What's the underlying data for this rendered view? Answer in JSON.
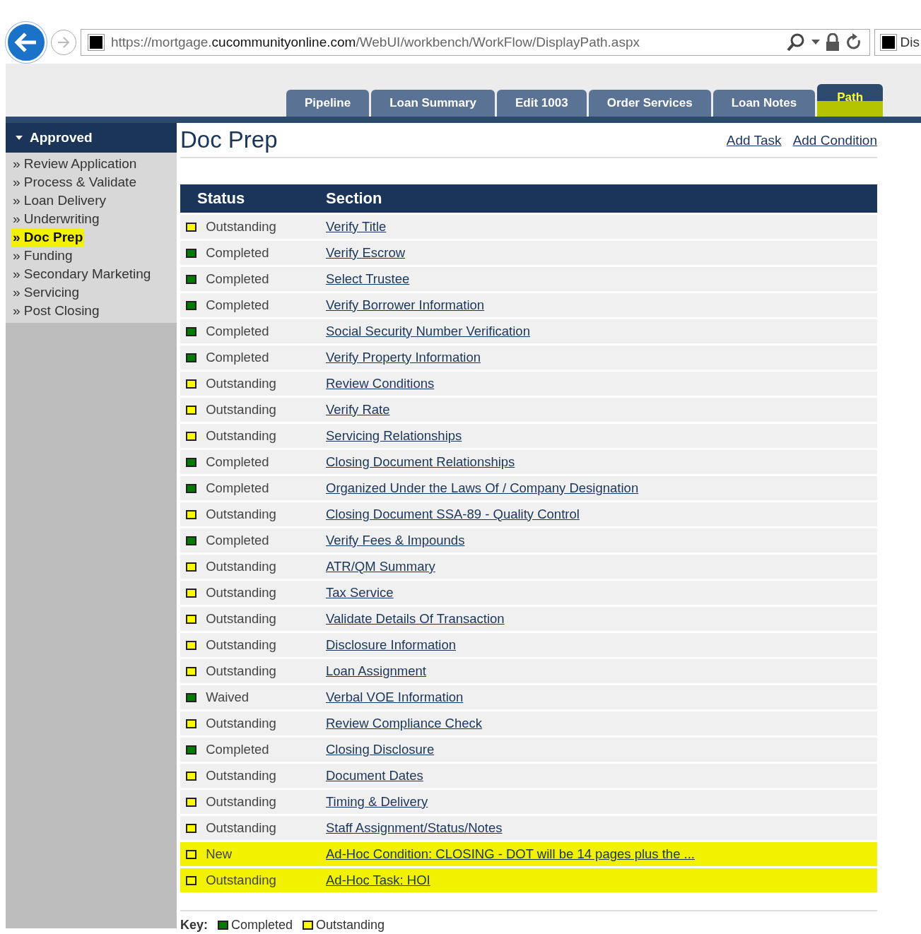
{
  "browser": {
    "url": {
      "scheme": "https://mortgage.",
      "domain": "cucommunityonline.com",
      "path": "/WebUI/workbench/WorkFlow/DisplayPath.aspx"
    },
    "next_tab": "Dis"
  },
  "tabs": [
    {
      "label": "Pipeline",
      "selected": false,
      "highlighted": false
    },
    {
      "label": "Loan Summary",
      "selected": false,
      "highlighted": false
    },
    {
      "label": "Edit 1003",
      "selected": false,
      "highlighted": false
    },
    {
      "label": "Order Services",
      "selected": false,
      "highlighted": false
    },
    {
      "label": "Loan Notes",
      "selected": false,
      "highlighted": false
    },
    {
      "label": "Path",
      "selected": true,
      "highlighted": true
    }
  ],
  "sidebar": {
    "heading": "Approved",
    "expanded": true,
    "items": [
      {
        "label": "» Review Application",
        "selected": false
      },
      {
        "label": "» Process & Validate",
        "selected": false
      },
      {
        "label": "» Loan Delivery",
        "selected": false
      },
      {
        "label": "» Underwriting",
        "selected": false
      },
      {
        "label": "» Doc Prep",
        "selected": true
      },
      {
        "label": "» Funding",
        "selected": false
      },
      {
        "label": "» Secondary Marketing",
        "selected": false
      },
      {
        "label": "» Servicing",
        "selected": false
      },
      {
        "label": "» Post Closing",
        "selected": false
      }
    ]
  },
  "page": {
    "title": "Doc Prep",
    "actions": [
      "Add Task",
      "Add Condition"
    ]
  },
  "table": {
    "columns": [
      "Status",
      "Section"
    ],
    "rows": [
      {
        "status": "Outstanding",
        "color": "#ffff00",
        "section": "Verify Title",
        "highlighted": false
      },
      {
        "status": "Completed",
        "color": "#007a00",
        "section": "Verify Escrow",
        "highlighted": false
      },
      {
        "status": "Completed",
        "color": "#007a00",
        "section": "Select Trustee",
        "highlighted": false
      },
      {
        "status": "Completed",
        "color": "#007a00",
        "section": "Verify Borrower Information",
        "highlighted": false
      },
      {
        "status": "Completed",
        "color": "#007a00",
        "section": "Social Security Number Verification",
        "highlighted": false
      },
      {
        "status": "Completed",
        "color": "#007a00",
        "section": "Verify Property Information",
        "highlighted": false
      },
      {
        "status": "Outstanding",
        "color": "#ffff00",
        "section": "Review Conditions",
        "highlighted": false
      },
      {
        "status": "Outstanding",
        "color": "#ffff00",
        "section": "Verify Rate",
        "highlighted": false
      },
      {
        "status": "Outstanding",
        "color": "#ffff00",
        "section": "Servicing Relationships",
        "highlighted": false
      },
      {
        "status": "Completed",
        "color": "#007a00",
        "section": "Closing Document Relationships",
        "highlighted": false
      },
      {
        "status": "Completed",
        "color": "#007a00",
        "section": "Organized Under the Laws Of / Company Designation",
        "highlighted": false
      },
      {
        "status": "Outstanding",
        "color": "#ffff00",
        "section": "Closing Document SSA-89 - Quality Control",
        "highlighted": false
      },
      {
        "status": "Completed",
        "color": "#007a00",
        "section": "Verify Fees & Impounds",
        "highlighted": false
      },
      {
        "status": "Outstanding",
        "color": "#ffff00",
        "section": "ATR/QM Summary",
        "highlighted": false
      },
      {
        "status": "Outstanding",
        "color": "#ffff00",
        "section": "Tax Service",
        "highlighted": false
      },
      {
        "status": "Outstanding",
        "color": "#ffff00",
        "section": "Validate Details Of Transaction",
        "highlighted": false
      },
      {
        "status": "Outstanding",
        "color": "#ffff00",
        "section": "Disclosure Information",
        "highlighted": false
      },
      {
        "status": "Outstanding",
        "color": "#ffff00",
        "section": "Loan Assignment",
        "highlighted": false
      },
      {
        "status": "Waived",
        "color": "#007a00",
        "section": "Verbal VOE Information",
        "highlighted": false
      },
      {
        "status": "Outstanding",
        "color": "#ffff00",
        "section": "Review Compliance Check",
        "highlighted": false
      },
      {
        "status": "Completed",
        "color": "#007a00",
        "section": "Closing Disclosure",
        "highlighted": false
      },
      {
        "status": "Outstanding",
        "color": "#ffff00",
        "section": "Document Dates",
        "highlighted": false
      },
      {
        "status": "Outstanding",
        "color": "#ffff00",
        "section": "Timing & Delivery",
        "highlighted": false
      },
      {
        "status": "Outstanding",
        "color": "#ffff00",
        "section": "Staff Assignment/Status/Notes",
        "highlighted": false
      },
      {
        "status": "New",
        "color": "#ffff00",
        "section": "Ad-Hoc Condition: CLOSING - DOT will be 14 pages plus the ...",
        "highlighted": true
      },
      {
        "status": "Outstanding",
        "color": "#ffff00",
        "section": "Ad-Hoc Task: HOI",
        "highlighted": true
      }
    ]
  },
  "key": {
    "label": "Key:",
    "items": [
      {
        "label": "Completed",
        "color": "#007a00"
      },
      {
        "label": "Outstanding",
        "color": "#ffff00"
      }
    ]
  }
}
